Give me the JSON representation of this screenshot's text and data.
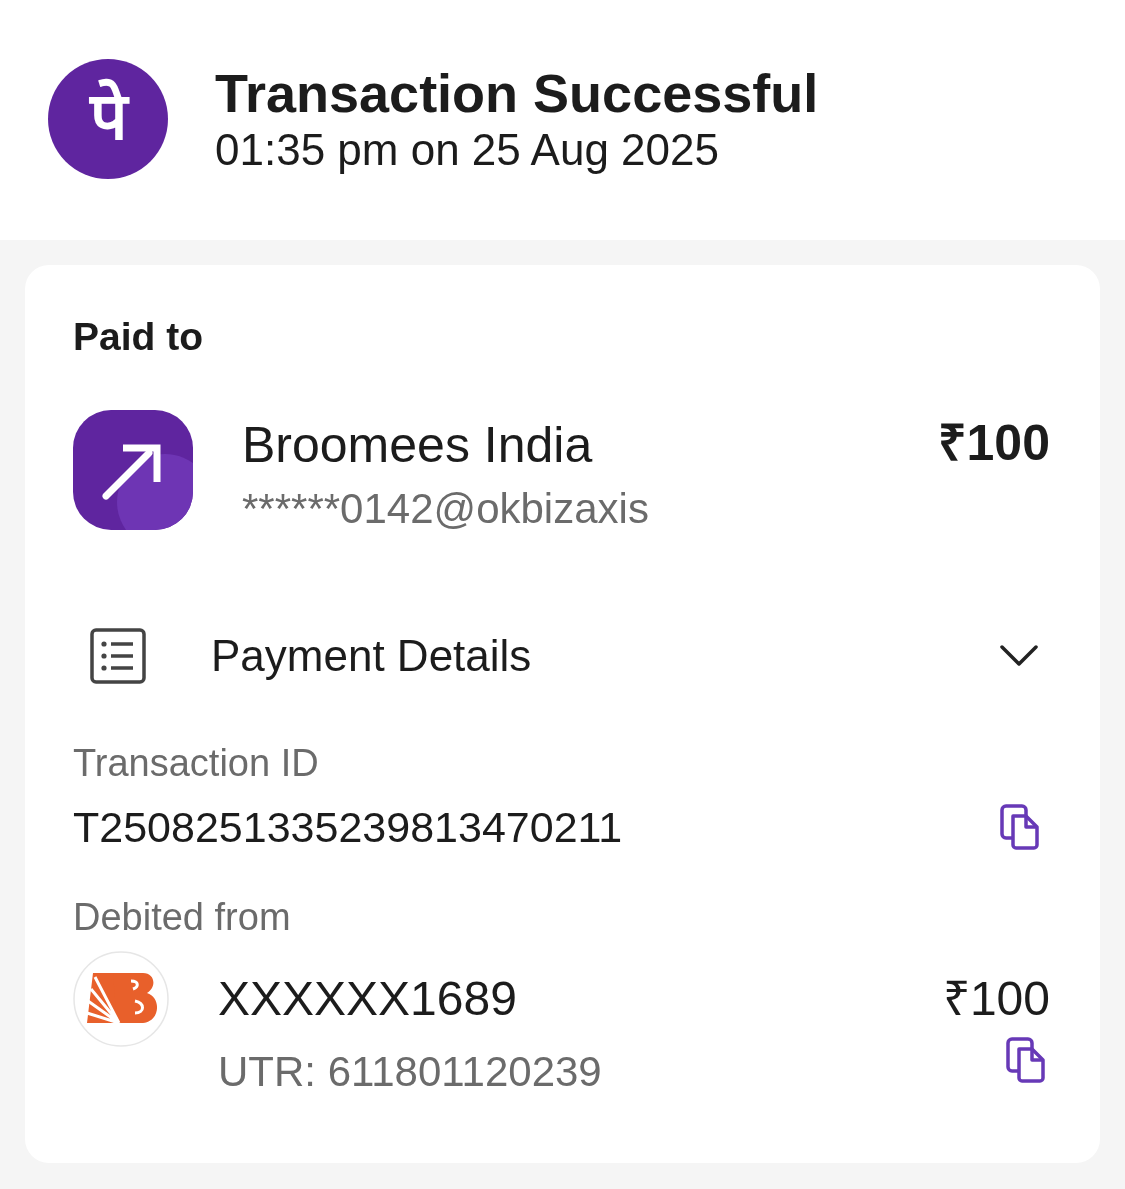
{
  "header": {
    "logo_text": "पे",
    "title": "Transaction Successful",
    "timestamp": "01:35 pm on 25 Aug 2025"
  },
  "paid_to": {
    "heading": "Paid to",
    "name": "Broomees India",
    "upi_id": "******0142@okbizaxis",
    "amount": "₹100"
  },
  "payment_details": {
    "label": "Payment Details",
    "fields": [
      {
        "label": "Transaction ID",
        "value": "T2508251335239813470211"
      }
    ]
  },
  "debited_from": {
    "label": "Debited from",
    "account": "XXXXXX1689",
    "utr": "UTR: 611801120239",
    "amount": "₹100"
  }
}
